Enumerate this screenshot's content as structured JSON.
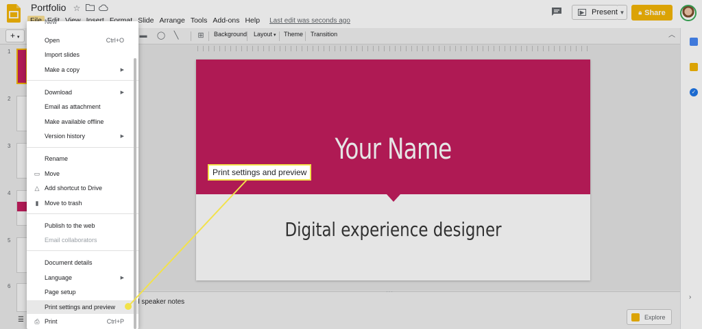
{
  "app": {
    "title": "Portfolio",
    "last_edit": "Last edit was seconds ago",
    "menus": [
      "File",
      "Edit",
      "View",
      "Insert",
      "Format",
      "Slide",
      "Arrange",
      "Tools",
      "Add-ons",
      "Help"
    ],
    "active_menu": "File"
  },
  "header": {
    "present_label": "Present",
    "share_label": "Share"
  },
  "toolbar": {
    "background_label": "Background",
    "layout_label": "Layout",
    "theme_label": "Theme",
    "transition_label": "Transition"
  },
  "filmstrip": {
    "slide_numbers": [
      "1",
      "2",
      "3",
      "4",
      "5",
      "6"
    ],
    "selected": "1"
  },
  "slide": {
    "name": "Your Name",
    "subtitle": "Digital experience designer"
  },
  "notes": {
    "text": "d speaker notes"
  },
  "explore": {
    "label": "Explore"
  },
  "file_menu": {
    "items": [
      {
        "label": "New",
        "partial": true
      },
      {
        "label": "Open",
        "shortcut": "Ctrl+O"
      },
      {
        "label": "Import slides"
      },
      {
        "label": "Make a copy",
        "submenu": true
      },
      {
        "label": "Download",
        "submenu": true
      },
      {
        "label": "Email as attachment"
      },
      {
        "label": "Make available offline"
      },
      {
        "label": "Version history",
        "submenu": true
      },
      {
        "label": "Rename"
      },
      {
        "label": "Move",
        "icon": "folder-icon"
      },
      {
        "label": "Add shortcut to Drive",
        "icon": "drive-shortcut-icon"
      },
      {
        "label": "Move to trash",
        "icon": "trash-icon"
      },
      {
        "label": "Publish to the web"
      },
      {
        "label": "Email collaborators",
        "disabled": true
      },
      {
        "label": "Document details"
      },
      {
        "label": "Language",
        "submenu": true
      },
      {
        "label": "Page setup"
      },
      {
        "label": "Print settings and preview",
        "highlighted": true
      },
      {
        "label": "Print",
        "shortcut": "Ctrl+P",
        "icon": "printer-icon"
      }
    ]
  },
  "callout": {
    "label": "Print settings and preview"
  },
  "colors": {
    "slide_accent": "#c2185b",
    "share": "#f4b400",
    "callout": "#f2e24a"
  }
}
